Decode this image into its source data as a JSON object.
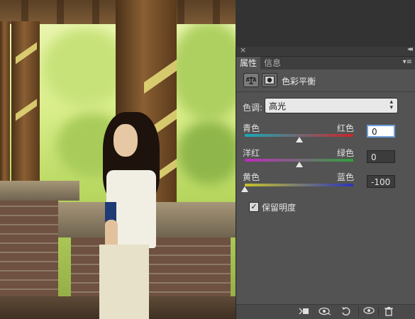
{
  "panel": {
    "tabs": [
      {
        "label": "属性",
        "active": true
      },
      {
        "label": "信息",
        "active": false
      }
    ],
    "title": "色彩平衡",
    "tone": {
      "label": "色调:",
      "value": "高光"
    },
    "sliders": [
      {
        "left": "青色",
        "right": "红色",
        "value": "0",
        "position": 0.5,
        "gradient": [
          "#19a9b8",
          "#c8262c"
        ],
        "focused": true
      },
      {
        "left": "洋红",
        "right": "绿色",
        "value": "0",
        "position": 0.5,
        "gradient": [
          "#c02bbd",
          "#2fa33a"
        ],
        "focused": false
      },
      {
        "left": "黄色",
        "right": "蓝色",
        "value": "-100",
        "position": 0.0,
        "gradient": [
          "#c8c32a",
          "#2a36b8"
        ],
        "focused": false
      }
    ],
    "preserve_luminosity": {
      "label": "保留明度",
      "checked": true
    }
  },
  "icons": {
    "close": "close-icon",
    "collapse": "collapse-arrows-icon",
    "panel_menu": "panel-menu-icon",
    "adjustment": "balance-scale-icon",
    "mask": "mask-icon",
    "clip": "clip-to-layer-icon",
    "view_previous": "view-previous-state-icon",
    "reset": "reset-icon",
    "visibility": "eye-icon",
    "delete": "trash-icon"
  },
  "glyphs": {
    "close": "×",
    "collapse": "◂◂",
    "panel_menu": "▾≡",
    "select_arrows": "▴▾",
    "check": "✓"
  }
}
